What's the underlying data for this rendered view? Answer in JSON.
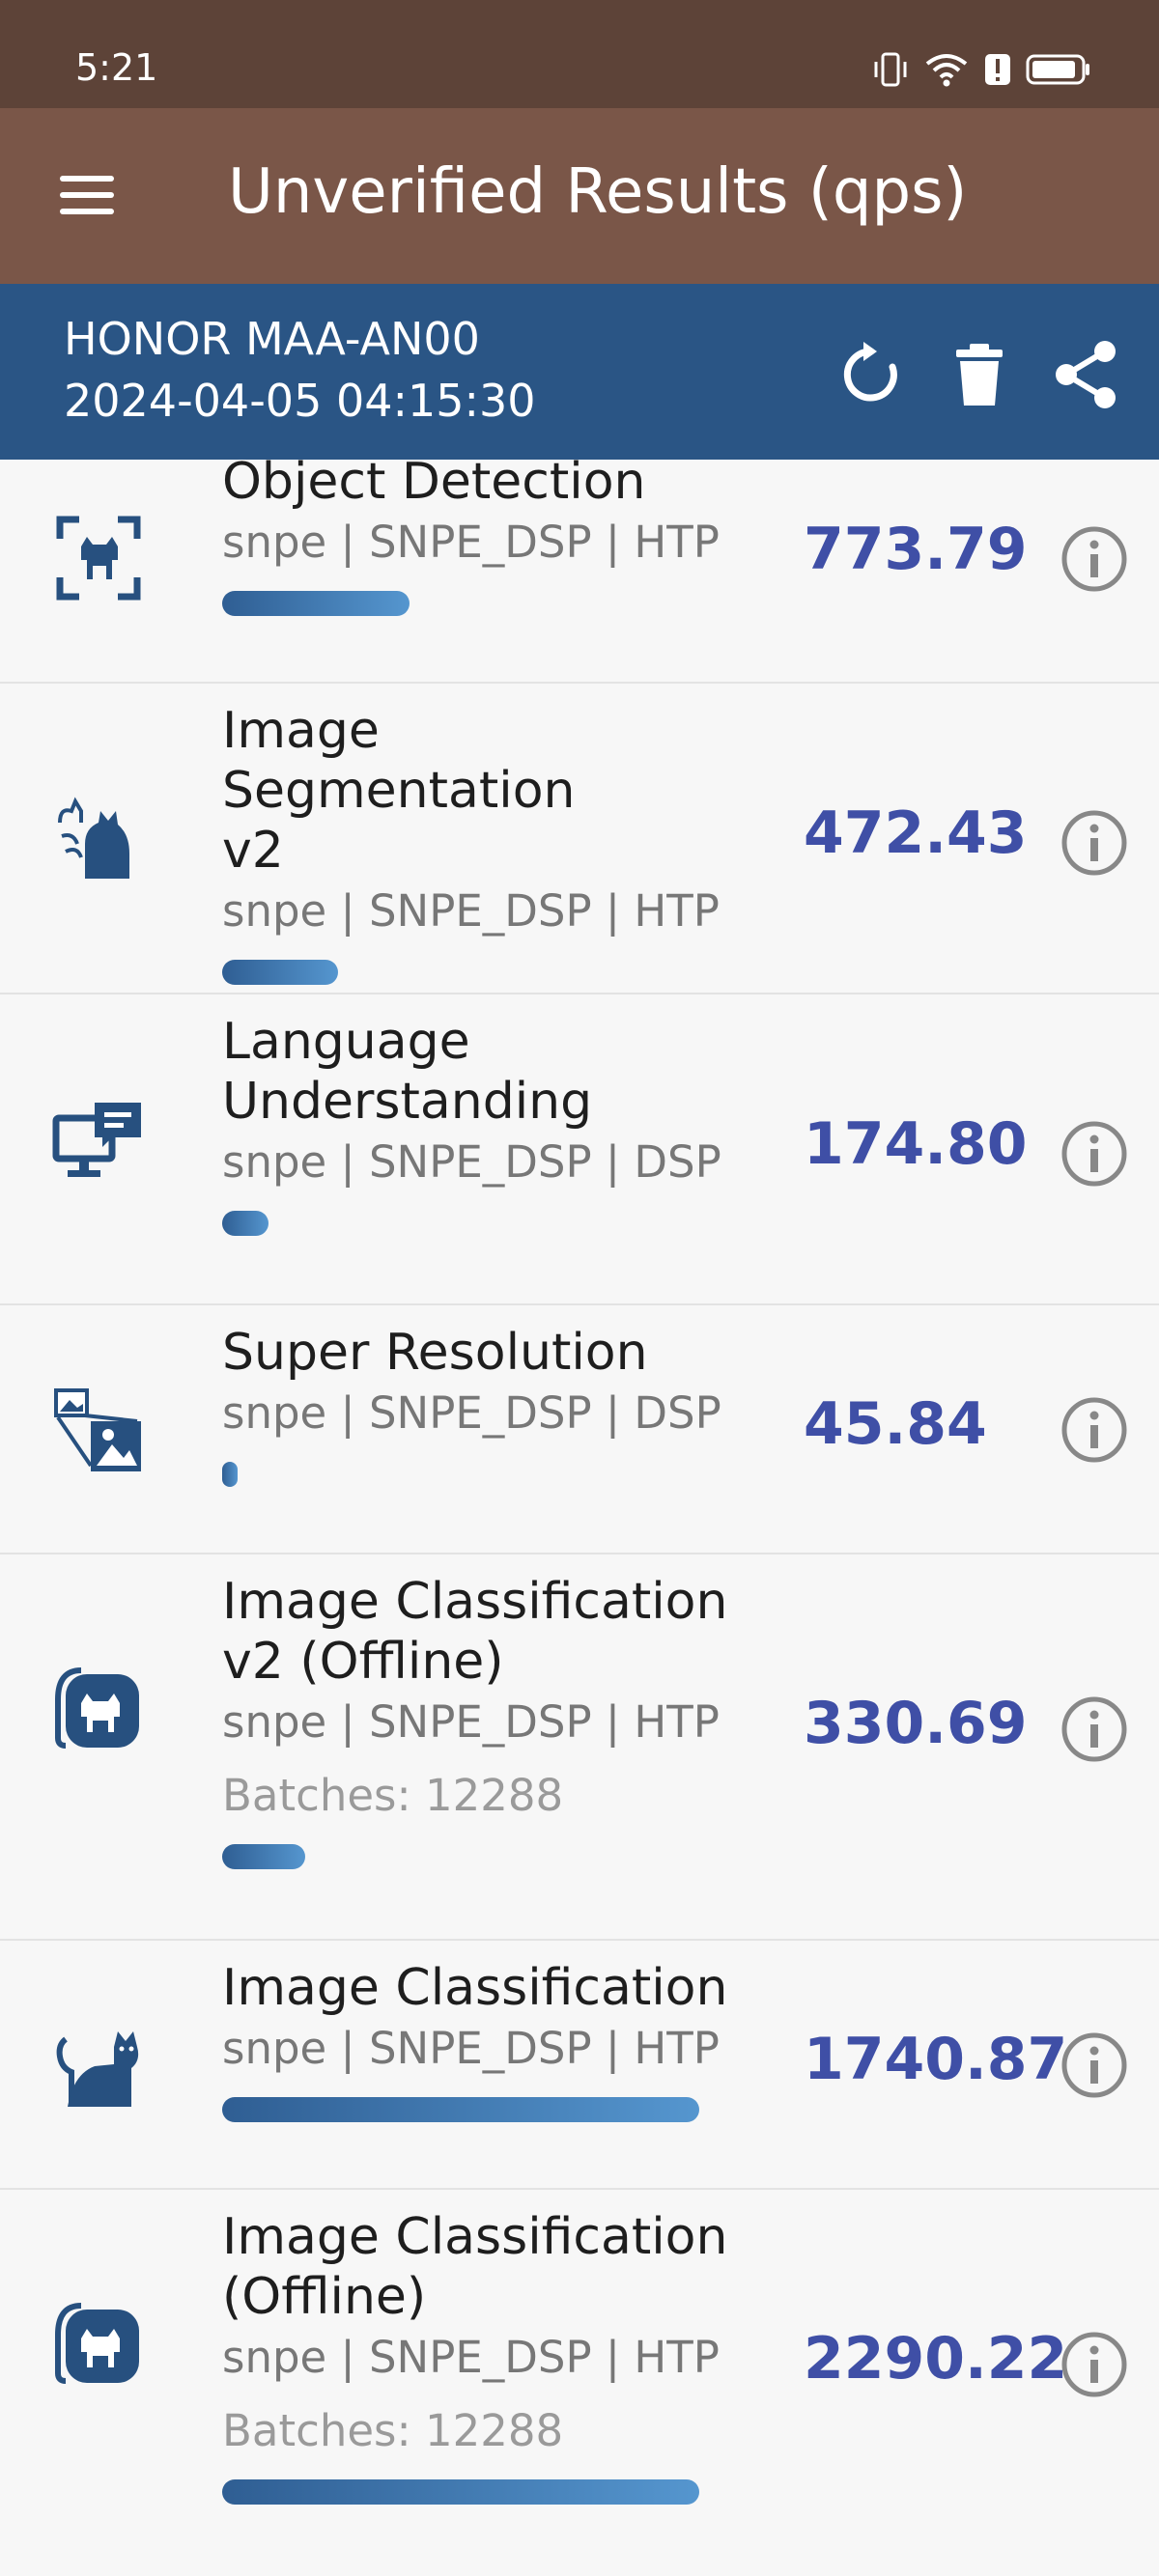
{
  "status_bar": {
    "time": "5:21",
    "icons": [
      "vibrate-icon",
      "wifi-icon",
      "alert-icon",
      "battery-icon"
    ]
  },
  "app_bar": {
    "title": "Unverified Results (qps)",
    "menu_icon": "menu-icon"
  },
  "info_bar": {
    "device": "HONOR MAA-AN00",
    "timestamp": "2024-04-05 04:15:30",
    "actions": [
      "refresh-icon",
      "delete-icon",
      "share-icon"
    ]
  },
  "colors": {
    "status_bar": "#5d4338",
    "app_bar": "#7a5648",
    "info_bar": "#2a5585",
    "score": "#3f4fa6",
    "bar_start": "#2f5e93",
    "bar_end": "#5596cf"
  },
  "results": [
    {
      "icon": "object-detection-icon",
      "name_lines": [
        "Object Detection"
      ],
      "backend": "snpe | SNPE_DSP | HTP",
      "batches": "",
      "score": "773.79",
      "progress": 0.39
    },
    {
      "icon": "image-segmentation-icon",
      "name_lines": [
        "Image Segmentation",
        "v2"
      ],
      "backend": "snpe | SNPE_DSP | HTP",
      "batches": "",
      "score": "472.43",
      "progress": 0.24
    },
    {
      "icon": "language-understanding-icon",
      "name_lines": [
        "Language",
        "Understanding"
      ],
      "backend": "snpe | SNPE_DSP | DSP",
      "batches": "",
      "score": "174.80",
      "progress": 0.09
    },
    {
      "icon": "super-resolution-icon",
      "name_lines": [
        "Super Resolution"
      ],
      "backend": "snpe | SNPE_DSP | DSP",
      "batches": "",
      "score": "45.84",
      "progress": 0.03
    },
    {
      "icon": "image-classification-offline-icon",
      "name_lines": [
        "Image Classification",
        "v2 (Offline)"
      ],
      "backend": "snpe | SNPE_DSP | HTP",
      "batches": "Batches: 12288",
      "score": "330.69",
      "progress": 0.17
    },
    {
      "icon": "image-classification-icon",
      "name_lines": [
        "Image Classification"
      ],
      "backend": "snpe | SNPE_DSP | HTP",
      "batches": "",
      "score": "1740.87",
      "progress": 1.0
    },
    {
      "icon": "image-classification-offline-icon",
      "name_lines": [
        "Image Classification",
        "(Offline)"
      ],
      "backend": "snpe | SNPE_DSP | HTP",
      "batches": "Batches: 12288",
      "score": "2290.22",
      "progress": 1.0
    }
  ]
}
